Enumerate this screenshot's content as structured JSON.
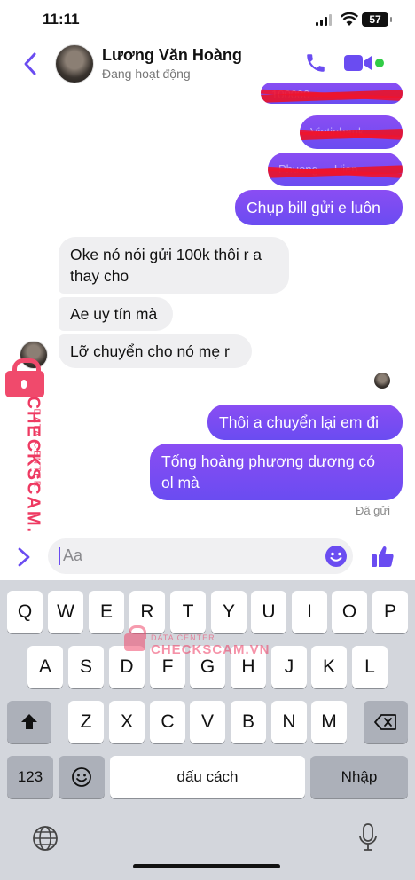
{
  "status_bar": {
    "time": "11:11",
    "battery": "57"
  },
  "header": {
    "contact_name": "Lương Văn Hoàng",
    "contact_status": "Đang hoạt động"
  },
  "messages": {
    "out_redacted": [
      "100000 ...",
      "Vietinbank",
      "Phuong ... Hien"
    ],
    "out_bill": "Chụp bill gửi e luôn",
    "in_1_line1": "Oke nó nói gửi 100k thôi r a",
    "in_1_line2": "thay cho",
    "in_2": "Ae uy tín mà",
    "in_3": "Lỡ chuyển cho nó mẹ r",
    "out_2": "Thôi a chuyển lại em đi",
    "out_3_line1": "Tống hoàng phương dương có",
    "out_3_line2": "ol mà",
    "delivered": "Đã gửi"
  },
  "watermark": {
    "brand": "CHECKSCAM.VN",
    "tag": "DATA CENTER"
  },
  "composer": {
    "placeholder": "Aa"
  },
  "keyboard": {
    "row1": [
      "Q",
      "W",
      "E",
      "R",
      "T",
      "Y",
      "U",
      "I",
      "O",
      "P"
    ],
    "row2": [
      "A",
      "S",
      "D",
      "F",
      "G",
      "H",
      "J",
      "K",
      "L"
    ],
    "row3": [
      "Z",
      "X",
      "C",
      "V",
      "B",
      "N",
      "M"
    ],
    "numbers": "123",
    "space": "dấu cách",
    "return": "Nhập"
  },
  "colors": {
    "accent": "#6a4cf1",
    "incoming_bg": "#efeff1",
    "online": "#31cc46",
    "watermark": "#ee3a62"
  }
}
